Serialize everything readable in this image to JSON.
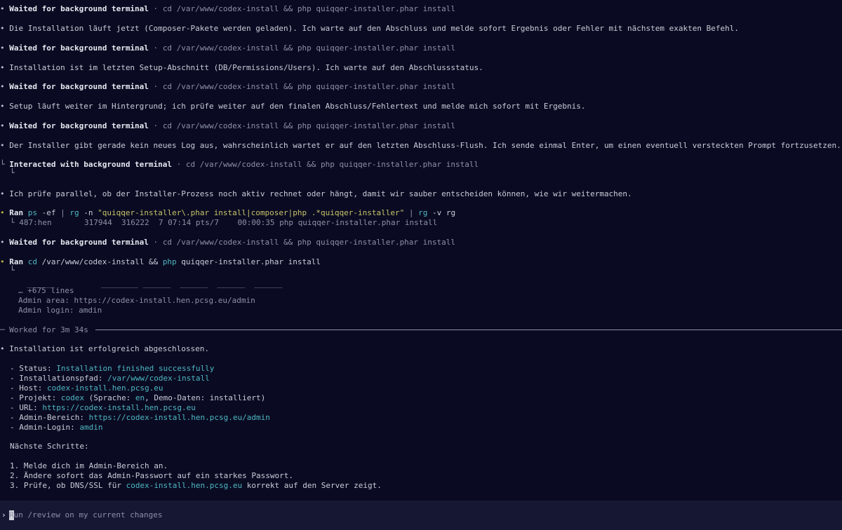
{
  "transcript": {
    "wait_label": "Waited for background terminal",
    "sep": " · ",
    "install_cmd": "cd /var/www/codex-install && php quiqqer-installer.phar install",
    "msg1": "Die Installation läuft jetzt (Composer-Pakete werden geladen). Ich warte auf den Abschluss und melde sofort Ergebnis oder Fehler mit nächstem exakten Befehl.",
    "msg2": "Installation ist im letzten Setup-Abschnitt (DB/Permissions/Users). Ich warte auf den Abschlussstatus.",
    "msg3": "Setup läuft weiter im Hintergrund; ich prüfe weiter auf den finalen Abschluss/Fehlertext und melde mich sofort mit Ergebnis.",
    "msg4": "Der Installer gibt gerade kein neues Log aus, wahrscheinlich wartet er auf den letzten Abschluss-Flush. Ich sende einmal Enter, um einen eventuell versteckten Prompt fortzusetzen.",
    "interacted_label": "Interacted with background terminal",
    "msg5": "Ich prüfe parallel, ob der Installer-Prozess noch aktiv rechnet oder hängt, damit wir sauber entscheiden können, wie wir weitermachen.",
    "ran_label": "Ran",
    "ps_cmd": {
      "p1": "ps",
      "p2": " -ef ",
      "p3": "| ",
      "p4": "rg",
      "p5": " -n ",
      "p6": "\"quiqqer-installer\\.phar install|composer|php .*quiqqer-installer\"",
      "p7": " | ",
      "p8": "rg",
      "p9": " -v rg"
    },
    "ps_output": "487:hen       317944  316222  7 07:14 pts/7    00:00:35 php quiqqer-installer.phar install",
    "run2": {
      "c1": "cd",
      "c2": " /var/www/codex-install && ",
      "c3": "php",
      "c4": " quiqqer-installer.phar install"
    },
    "art_line": "______          ________ ______  ______  ______  ______",
    "more_lines": "… +675 lines",
    "admin_area_line": "Admin area: https://codex-install.hen.pcsg.eu/admin",
    "admin_login_line": "Admin login: amdin",
    "worked_label": "─ Worked for 3m 34s ",
    "success_msg": "Installation ist erfolgreich abgeschlossen.",
    "details": {
      "status_k": "- Status: ",
      "status_v": "Installation finished successfully",
      "path_k": "- Installationspfad: ",
      "path_v": "/var/www/codex-install",
      "host_k": "- Host: ",
      "host_v": "codex-install.hen.pcsg.eu",
      "proj_k": "- Projekt: ",
      "proj_v": "codex",
      "proj_m1": " (Sprache: ",
      "proj_lang": "en",
      "proj_m2": ", Demo-Daten: installiert)",
      "url_k": "- URL: ",
      "url_v": "https://codex-install.hen.pcsg.eu",
      "admin_k": "- Admin-Bereich: ",
      "admin_v": "https://codex-install.hen.pcsg.eu/admin",
      "login_k": "- Admin-Login: ",
      "login_v": "amdin"
    },
    "next_title": "Nächste Schritte:",
    "steps": {
      "s1": "1. Melde dich im Admin-Bereich an.",
      "s2": "2. Ändere sofort das Admin-Passwort auf ein starkes Passwort.",
      "s3a": "3. Prüfe, ob DNS/SSL für ",
      "s3b": "codex-install.hen.pcsg.eu",
      "s3c": " korrekt auf den Server zeigt."
    }
  },
  "composer": {
    "prompt_symbol": "›",
    "placeholder": "Run /review on my current changes"
  },
  "glyphs": {
    "bullet": "•",
    "corner": "└"
  },
  "colors": {
    "background": "#0a0b22",
    "accent_cyan": "#4fb6c2",
    "accent_yellow": "#c2b64a"
  }
}
